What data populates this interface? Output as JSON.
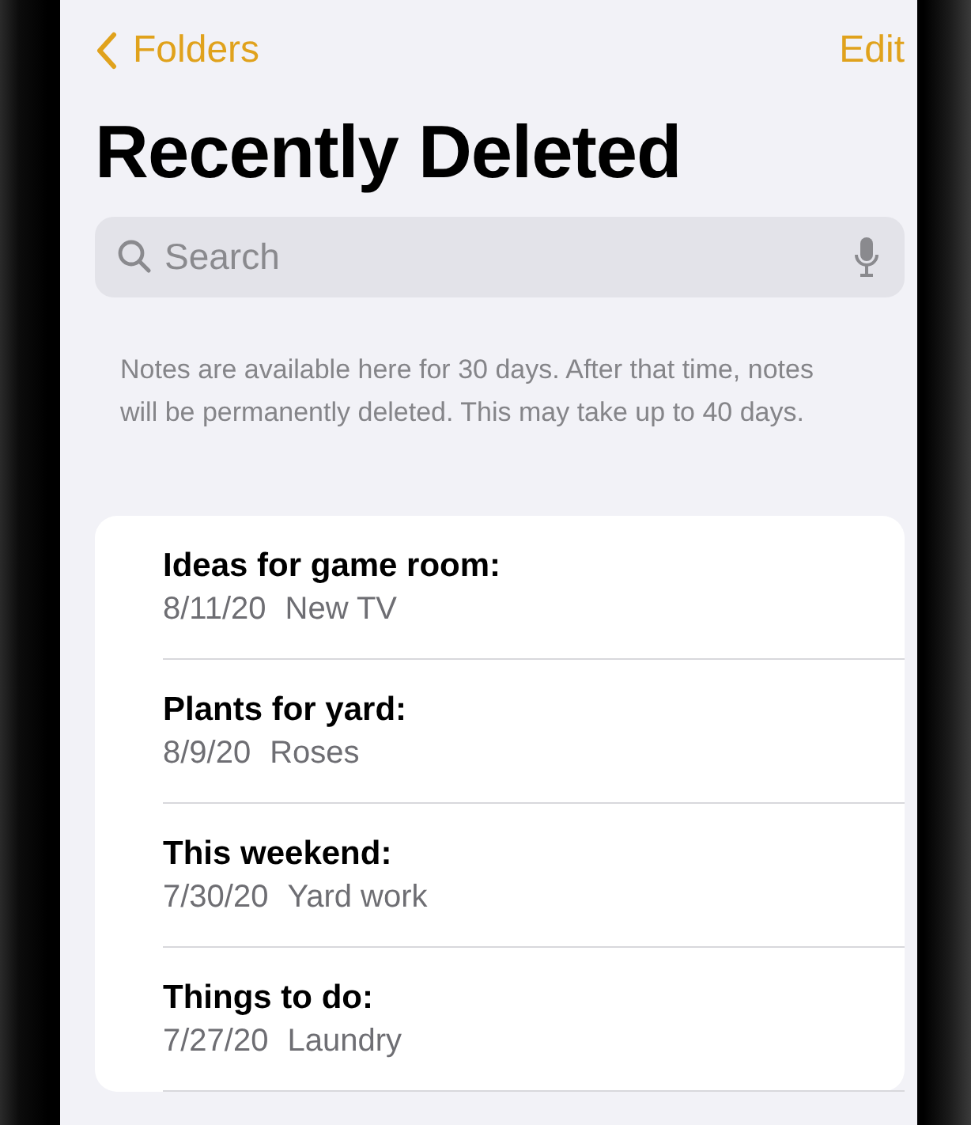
{
  "nav": {
    "back_label": "Folders",
    "action": "Edit"
  },
  "title": "Recently Deleted",
  "search": {
    "placeholder": "Search"
  },
  "info": "Notes are available here for 30 days. After that time, notes will be permanently deleted. This may take up to 40 days.",
  "notes": [
    {
      "title": "Ideas for game room:",
      "date": "8/11/20",
      "preview": "New TV"
    },
    {
      "title": "Plants for yard:",
      "date": "8/9/20",
      "preview": "Roses"
    },
    {
      "title": "This weekend:",
      "date": "7/30/20",
      "preview": "Yard work"
    },
    {
      "title": "Things to do:",
      "date": "7/27/20",
      "preview": "Laundry"
    }
  ]
}
